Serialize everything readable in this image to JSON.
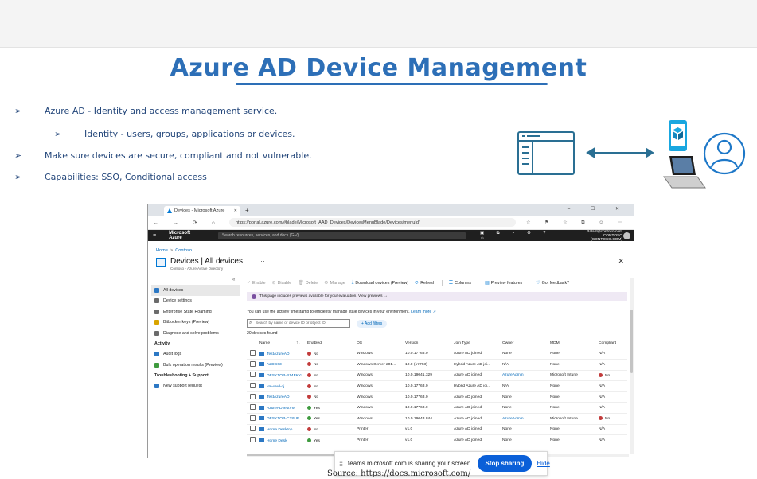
{
  "slide": {
    "title": "Azure AD Device Management",
    "bullets": [
      {
        "level": 1,
        "text": "Azure AD -  Identity and access management service."
      },
      {
        "level": 2,
        "text": "Identity -  users, groups, applications or devices."
      },
      {
        "level": 1,
        "text": "Make sure devices are secure, compliant and not vulnerable."
      },
      {
        "level": 1,
        "text": "Capabilities: SSO, Conditional access"
      }
    ],
    "bullet_glyph": "➢",
    "source": "Source: https://docs.microsoft.com/"
  },
  "diagram_icons": [
    "app-window-icon",
    "bidirectional-arrow-icon",
    "mobile-app-icon",
    "laptop-icon",
    "user-circle-icon"
  ],
  "colors": {
    "title": "#2d6fb7",
    "accent": "#0078d4",
    "teal": "#2a6f93",
    "azure_bar": "#1f1f1f",
    "stop_button": "#0a5fd8"
  },
  "browser": {
    "tab_title": "Devices - Microsoft Azure",
    "tab_close": "✕",
    "new_tab": "+",
    "window_controls": "–  ☐  ✕",
    "nav_glyphs": "←  →  ⟳  ⌂",
    "url": "https://portal.azure.com/#blade/Microsoft_AAD_Devices/DevicesMenuBlade/Devices/menuId/",
    "toolbar_glyphs": "☆  ⚑  ☆  ⧉  ☺  ⋯"
  },
  "azure": {
    "hamburger": "≡",
    "brand": "Microsoft Azure",
    "search_placeholder": "Search resources, services, and docs (G+/)",
    "tool_glyphs": "▣ ⧉ ◔ ⚙ ? ☺",
    "user_email": "BalaS@contoso.com",
    "user_tenant": "CONTOSO (CONTOSO.COM)"
  },
  "breadcrumb": [
    "Home",
    "Contoso"
  ],
  "breadcrumb_sep": ">",
  "page": {
    "title": "Devices | All devices",
    "subtitle": "Contoso - Azure Active Directory",
    "more": "···",
    "close": "✕",
    "collapse": "«"
  },
  "sidenav": {
    "items": [
      {
        "label": "All devices",
        "active": true
      },
      {
        "label": "Device settings"
      },
      {
        "label": "Enterprise State Roaming"
      },
      {
        "label": "BitLocker keys (Preview)"
      },
      {
        "label": "Diagnose and solve problems"
      }
    ],
    "activity_header": "Activity",
    "activity_items": [
      "Audit logs",
      "Bulk operation results (Preview)"
    ],
    "support_header": "Troubleshooting + Support",
    "support_items": [
      "New support request"
    ]
  },
  "commands": {
    "enable": "Enable",
    "disable": "Disable",
    "delete": "Delete",
    "manage": "Manage",
    "download": "Download devices (Preview)",
    "refresh": "Refresh",
    "columns": "Columns",
    "preview_features": "Preview features",
    "feedback": "Got feedback?"
  },
  "preview_notice": "This page includes previews available for your evaluation. View previews →",
  "info_text": "You can use the activity timestamp to efficiently manage stale devices in your environment.",
  "info_link": "Learn more ↗",
  "search_placeholder": "Search by name or device ID or object ID",
  "add_filters": "+ Add filters",
  "device_count": "20 devices found",
  "table": {
    "columns": [
      "",
      "Name",
      "↑↓",
      "Enabled",
      "OS",
      "Version",
      "Join Type",
      "Owner",
      "MDM",
      "Compliant"
    ],
    "rows": [
      {
        "name": "TestAzureAD",
        "enabled": "No",
        "os": "Windows",
        "version": "10.0.17763.0",
        "join": "Azure AD joined",
        "owner": "None",
        "mdm": "None",
        "compliant": "N/A"
      },
      {
        "name": "AZDC03",
        "enabled": "No",
        "os": "Windows Server 201...",
        "version": "10.0 (17763)",
        "join": "Hybrid Azure AD joi...",
        "owner": "N/A",
        "mdm": "None",
        "compliant": "N/A"
      },
      {
        "name": "DESKTOP-B14EKKI",
        "enabled": "No",
        "os": "Windows",
        "version": "10.0.19041.329",
        "join": "Azure AD joined",
        "owner": "AzureAdmin",
        "mdm": "Microsoft Intune",
        "compliant": "No"
      },
      {
        "name": "vm-wvd-dj",
        "enabled": "No",
        "os": "Windows",
        "version": "10.0.17763.0",
        "join": "Hybrid Azure AD joi...",
        "owner": "N/A",
        "mdm": "None",
        "compliant": "N/A"
      },
      {
        "name": "TestAzureAD",
        "enabled": "No",
        "os": "Windows",
        "version": "10.0.17763.0",
        "join": "Azure AD joined",
        "owner": "None",
        "mdm": "None",
        "compliant": "N/A"
      },
      {
        "name": "AzureADTestVM",
        "enabled": "Yes",
        "os": "Windows",
        "version": "10.0.17763.0",
        "join": "Azure AD joined",
        "owner": "None",
        "mdm": "None",
        "compliant": "N/A"
      },
      {
        "name": "DESKTOP-C2SUE...",
        "enabled": "Yes",
        "os": "Windows",
        "version": "10.0.19043.844",
        "join": "Azure AD joined",
        "owner": "AzureAdmin",
        "mdm": "Microsoft Intune",
        "compliant": "No"
      },
      {
        "name": "Home Desktop",
        "enabled": "No",
        "os": "Printer",
        "version": "v1.0",
        "join": "Azure AD joined",
        "owner": "None",
        "mdm": "None",
        "compliant": "N/A"
      },
      {
        "name": "Home Desk",
        "enabled": "Yes",
        "os": "Printer",
        "version": "v1.0",
        "join": "Azure AD joined",
        "owner": "None",
        "mdm": "None",
        "compliant": "N/A"
      }
    ]
  },
  "sharebar": {
    "grip": "⁞⁞",
    "text": "teams.microsoft.com is sharing your screen.",
    "stop": "Stop sharing",
    "hide": "Hide"
  }
}
